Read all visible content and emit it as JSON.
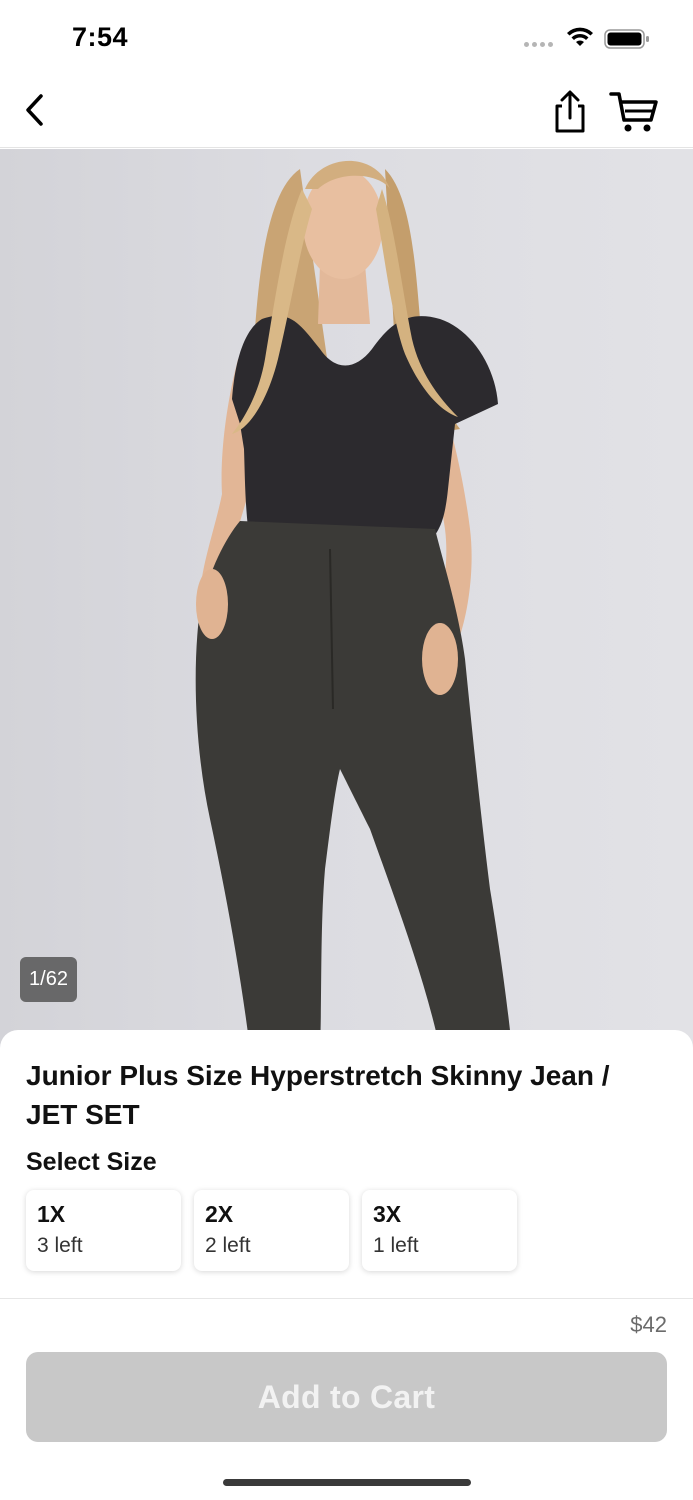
{
  "status_bar": {
    "time": "7:54"
  },
  "nav": {
    "back": "back",
    "share": "share",
    "cart": "cart"
  },
  "hero": {
    "photo_counter": "1/62"
  },
  "product": {
    "title": "Junior Plus Size Hyperstretch Skinny Jean / JET SET",
    "select_size_label": "Select Size",
    "sizes": [
      {
        "name": "1X",
        "stock": "3 left"
      },
      {
        "name": "2X",
        "stock": "2 left"
      },
      {
        "name": "3X",
        "stock": "1 left"
      }
    ]
  },
  "footer": {
    "price": "$42",
    "add_to_cart_label": "Add to Cart"
  },
  "colors": {
    "button_disabled": "#c8c8c8",
    "hero_bg": "#dcdce1",
    "top_color": "#2c2a2e",
    "pants_color": "#3b3a37"
  }
}
